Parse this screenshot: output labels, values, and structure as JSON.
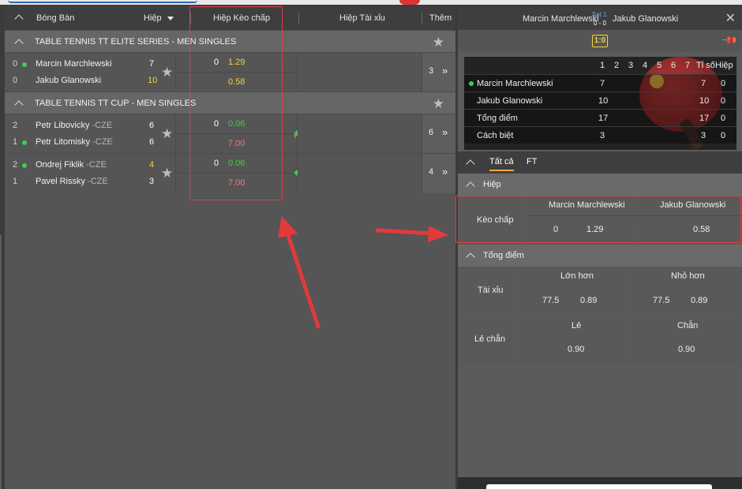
{
  "left": {
    "header": {
      "sport": "Bóng Bàn",
      "period": "Hiệp",
      "handicap": "Hiệp Kèo chấp",
      "overunder": "Hiệp Tài xỉu",
      "more": "Thêm"
    },
    "leagues": [
      {
        "name": "TABLE TENNIS TT ELITE SERIES - MEN SINGLES",
        "matches": [
          {
            "p1": {
              "set": "0",
              "name": "Marcin Marchlewski",
              "country": "",
              "score": "7",
              "serving": true
            },
            "p2": {
              "set": "0",
              "name": "Jakub Glanowski",
              "country": "",
              "score": "10",
              "serving": false
            },
            "hcp": "0",
            "odd1": "1.29",
            "odd2": "0.58",
            "more": "3"
          }
        ]
      },
      {
        "name": "TABLE TENNIS TT CUP - MEN SINGLES",
        "matches": [
          {
            "p1": {
              "set": "2",
              "name": "Petr Libovicky",
              "country": " -CZE",
              "score": "6",
              "serving": false
            },
            "p2": {
              "set": "1",
              "name": "Petr Litomisky",
              "country": " -CZE",
              "score": "6",
              "serving": true
            },
            "hcp": "0",
            "odd1": "0.06",
            "odd2": "7.00",
            "more": "6"
          },
          {
            "p1": {
              "set": "2",
              "name": "Ondrej Fiklik",
              "country": " -CZE",
              "score": "4",
              "serving": true
            },
            "p2": {
              "set": "1",
              "name": "Pavel Rissky",
              "country": " -CZE",
              "score": "3",
              "serving": false
            },
            "hcp": "0",
            "odd1": "0.06",
            "odd2": "7.00",
            "more": "4"
          }
        ]
      }
    ]
  },
  "right": {
    "header": {
      "p1": "Marcin Marchlewski",
      "p2": "Jakub Glanowski",
      "set_label": "Set 1",
      "set_score": "0 - 0",
      "close": "✕"
    },
    "score_badge": "1:0",
    "board": {
      "cols": [
        "1",
        "2",
        "3",
        "4",
        "5",
        "6",
        "7",
        "Tỉ số",
        "Hiệp"
      ],
      "rows": [
        {
          "name": "Marcin Marchlewski",
          "g1": "7",
          "total": "7",
          "sets": "0",
          "serving": true
        },
        {
          "name": "Jakub Glanowski",
          "g1": "10",
          "total": "10",
          "sets": "0",
          "serving": false
        },
        {
          "name": "Tổng điểm",
          "g1": "17",
          "total": "17",
          "sets": "0",
          "serving": false
        },
        {
          "name": "Cách biệt",
          "g1": "3",
          "total": "3",
          "sets": "0",
          "serving": false
        }
      ]
    },
    "tabs": {
      "all": "Tất cả",
      "ft": "FT"
    },
    "sections": {
      "period": "Hiệp",
      "total_points": "Tổng điểm"
    },
    "handicap": {
      "label": "Kèo chấp",
      "p1": "Marcin Marchlewski",
      "p2": "Jakub Glanowski",
      "hcp": "0",
      "odd1": "1.29",
      "odd2": "0.58"
    },
    "overunder": {
      "label": "Tài xỉu",
      "over": "Lớn hơn",
      "under": "Nhỏ hơn",
      "line1": "77.5",
      "odd1": "0.89",
      "line2": "77.5",
      "odd2": "0.89"
    },
    "oddeven": {
      "label": "Lẻ chẵn",
      "odd_label": "Lẻ",
      "even_label": "Chẵn",
      "odd1": "0.90",
      "odd2": "0.90"
    }
  },
  "colors": {
    "accent_yellow": "#f3d33b",
    "accent_green": "#3ed04a",
    "accent_red": "#e04040",
    "tab_underline": "#f3a93b"
  }
}
